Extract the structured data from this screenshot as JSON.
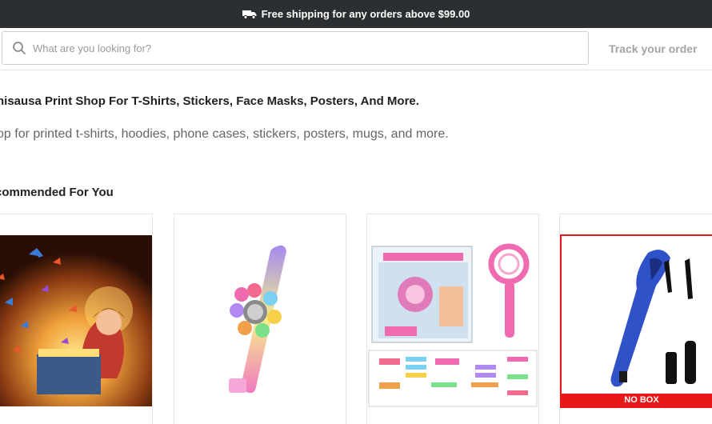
{
  "announcement": {
    "text": "Free shipping for any orders above $99.00",
    "icon": "truck-icon"
  },
  "search": {
    "placeholder": "What are you looking for?",
    "value": "",
    "icon": "search-icon"
  },
  "header": {
    "track_order_label": "Track your order"
  },
  "intro": {
    "title": "nisausa Print Shop For T-Shirts, Stickers, Face Masks, Posters, And More.",
    "subtitle": "op for printed t-shirts, hoodies, phone cases, stickers, posters, mugs, and more."
  },
  "recommended": {
    "title": "commended For You",
    "products": [
      {
        "image": "girl-with-butterflies-box"
      },
      {
        "image": "fidget-spinner-wristband"
      },
      {
        "image": "hair-braider-kit"
      },
      {
        "image": "hair-curler",
        "badge": "NO BOX"
      }
    ]
  },
  "colors": {
    "topbar_bg": "#2b2f31",
    "badge_red": "#e81818"
  }
}
